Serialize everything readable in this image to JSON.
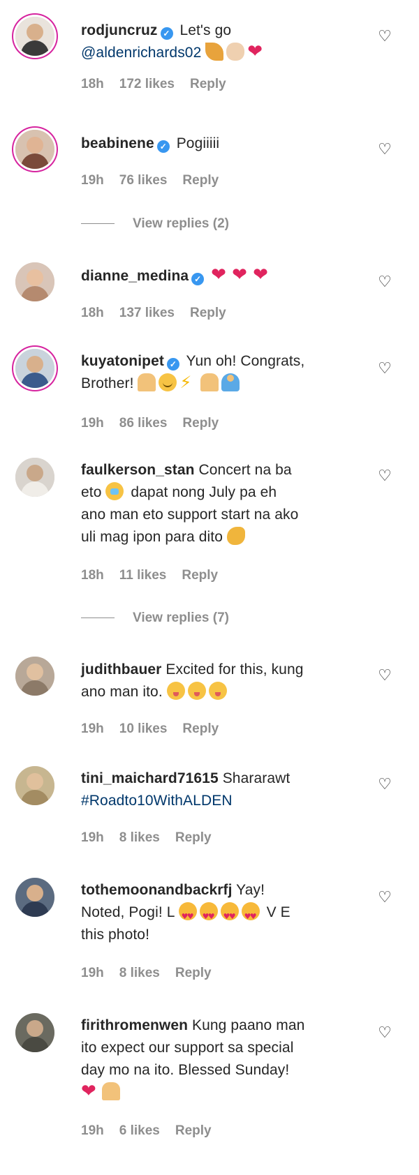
{
  "comments": [
    {
      "username": "rodjuncruz",
      "verified": true,
      "text_before": "Let's go",
      "mention": "@aldenrichards02",
      "emojis": [
        "party-popper",
        "clapping-hands",
        "red-heart"
      ],
      "time": "18h",
      "likes": "172 likes",
      "reply": "Reply",
      "ring": true,
      "avatar_color": "#3a3a3a"
    },
    {
      "username": "beabinene",
      "verified": true,
      "text": "Pogiiiii",
      "time": "19h",
      "likes": "76 likes",
      "reply": "Reply",
      "view_replies": "View replies (2)",
      "ring": true,
      "avatar_color": "#7a4a3a"
    },
    {
      "username": "dianne_medina",
      "verified": true,
      "emojis": [
        "red-heart",
        "red-heart",
        "red-heart"
      ],
      "time": "18h",
      "likes": "137 likes",
      "reply": "Reply",
      "ring": false,
      "avatar_color": "#b58a6f"
    },
    {
      "username": "kuyatonipet",
      "verified": true,
      "text_line1": "Yun oh! Congrats,",
      "text_line2": "Brother!",
      "emojis": [
        "raising-hands",
        "smiling-face",
        "high-voltage",
        "folded-hands",
        "person-bowing"
      ],
      "time": "19h",
      "likes": "86 likes",
      "reply": "Reply",
      "ring": true,
      "avatar_color": "#3b5b8c"
    },
    {
      "username": "faulkerson_stan",
      "text_line1": "Concert na ba",
      "text_line2": "eto",
      "text_line2_after": "dapat nong July pa eh",
      "text_line3": "ano man eto support start na ako",
      "text_line4": "uli mag ipon para dito",
      "emojis": [
        "anxious-face",
        "flexed-biceps"
      ],
      "time": "18h",
      "likes": "11 likes",
      "reply": "Reply",
      "view_replies": "View replies (7)",
      "avatar_color": "#d9d4ce"
    },
    {
      "username": "judithbauer",
      "text_line1": "Excited for this, kung",
      "text_line2": "ano man ito.",
      "emojis": [
        "yum-face",
        "yum-face",
        "yum-face"
      ],
      "time": "19h",
      "likes": "10 likes",
      "reply": "Reply",
      "avatar_color": "#8c7a68"
    },
    {
      "username": "tini_maichard71615",
      "text_line1": "Shararawt",
      "hashtag": "#Roadto10WithALDEN",
      "time": "19h",
      "likes": "8 likes",
      "reply": "Reply",
      "avatar_color": "#a38c62"
    },
    {
      "username": "tothemoonandbackrfj",
      "text_line1": "Yay!",
      "text_line2_a": "Noted, Pogi! L",
      "text_line2_b": "V E",
      "text_line3": "this photo!",
      "emojis": [
        "heart-eyes",
        "heart-eyes",
        "heart-eyes",
        "heart-eyes"
      ],
      "time": "19h",
      "likes": "8 likes",
      "reply": "Reply",
      "avatar_color": "#2e3b52"
    },
    {
      "username": "firithromenwen",
      "text_line1": "Kung paano man",
      "text_line2": "ito expect our support sa special",
      "text_line3": "day mo na ito. Blessed Sunday!",
      "emojis": [
        "red-heart",
        "folded-hands"
      ],
      "time": "19h",
      "likes": "6 likes",
      "reply": "Reply",
      "avatar_color": "#4a4a42"
    }
  ],
  "icons": {
    "verified": "✓",
    "like": "♡"
  },
  "colors": {
    "text": "#262626",
    "secondary": "#8e8e8e",
    "verified_blue": "#3897f0",
    "link": "#00376b",
    "story_ring": "#d6249f"
  }
}
